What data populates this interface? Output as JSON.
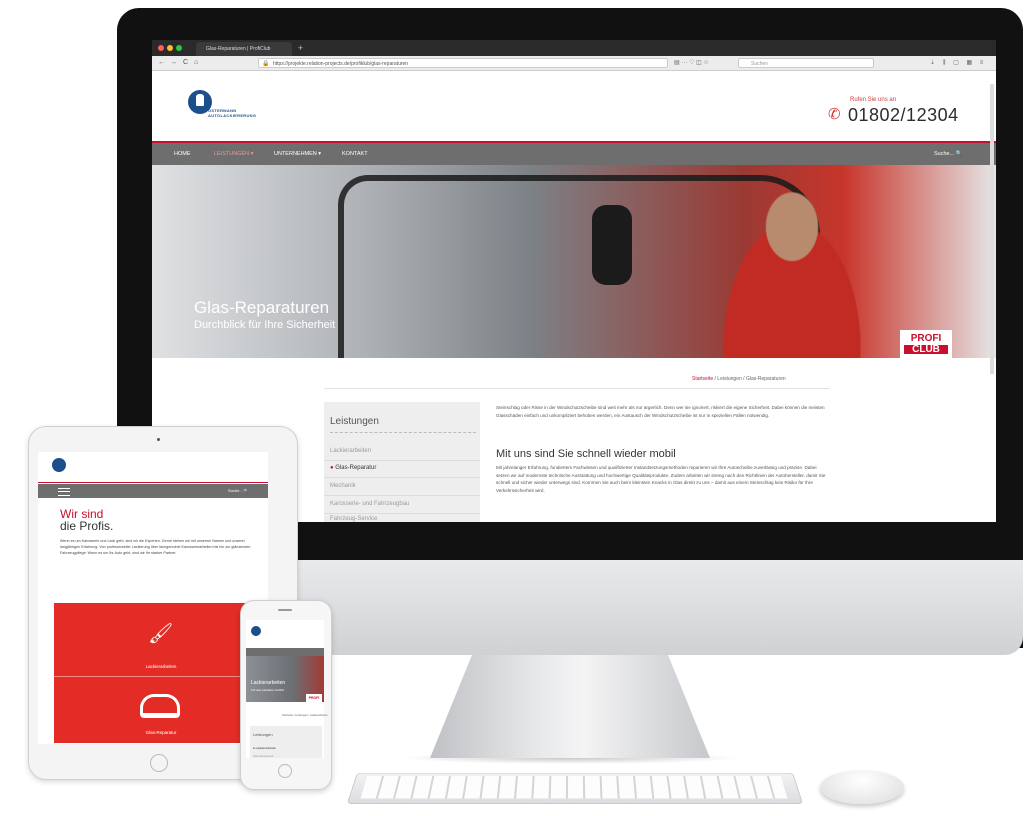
{
  "browser": {
    "tab_title": "Glas-Reparaturen | ProfiClub",
    "tab_add": "+",
    "back_glyph": "←",
    "forward_glyph": "→",
    "reload_glyph": "C",
    "home_glyph": "⌂",
    "url": "https://projekte.relation-projects.de/profiklub/glas-reparaturen",
    "url_icons": "▤ ··· ♡ ◫ ☆",
    "search_placeholder": "Suchen",
    "toolbar_icons": "⇣ ⫼ ▢ ▦ ≡"
  },
  "site": {
    "logo_text_line1": "OSTERMANN",
    "logo_text_line2": "AUTOLACKIERERUNG",
    "call_label": "Rufen Sie uns an",
    "phone": "01802/12304",
    "nav": [
      "HOME",
      "LEISTUNGEN ▾",
      "UNTERNEHMEN ▾",
      "KONTAKT"
    ],
    "search_link": "Suche... 🔍",
    "hero_title": "Glas-Reparaturen",
    "hero_subtitle": "Durchblick für Ihre Sicherheit",
    "badge_top": "PROFI",
    "badge_bottom": "CLUB",
    "breadcrumb": {
      "home": "Startseite",
      "sep": " / ",
      "section": "Leistungen",
      "current": "Glas-Reparaturen"
    },
    "sidebar": {
      "heading": "Leistungen",
      "items": [
        "Lackierarbeiten",
        "Glas-Reparatur",
        "Mechanik",
        "Karosserie- und Fahrzeugbau",
        "Fahrzeug-Service"
      ],
      "selected_bullet": "●"
    },
    "intro": "Steinschlag oder Risse in der Windschutzscheibe sind weit mehr als nur ärgerlich. Denn wer sie ignoriert, riskiert die eigene Sicherheit. Dabei können die meisten Glasschäden einfach und unkompliziert behoben werden, ein Austausch der Windschutzscheibe ist nur in speziellen Fällen notwendig.",
    "h2": "Mit uns sind Sie schnell wieder mobil",
    "body": "Mit jahrelanger Erfahrung, fundiertem Fachwissen und qualifizierter Instandsetzungsmethoden reparieren wir Ihre Autoscheibe zuverlässig und präzise. Dabei setzen wir auf modernste technische Ausstattung und hochwertige Qualitätsprodukte. Zudem arbeiten wir streng nach den Richtlinien der Autohersteller, damit Sie schnell und sicher wieder unterwegs sind. Kommen Sie auch beim kleinsten Knacks in Glas direkt zu uns – damit aus einem Steinschlag kein Risiko für Ihre Verkehrssicherheit wird."
  },
  "ipad": {
    "search_text": "Suche... 🔍",
    "headline_red": "Wir sind",
    "headline_dark": "die Profis.",
    "paragraph": "Wenn es um Karosserie und Lack geht, sind wir die Experten. Gerne stehen wir mit unserem Namen und unserer langjährigen Erfahrung. Von professioneller Lackierung über fachgerechte Karosseriearbeiten bis hin zur glänzenden Fahrzeugpflege: Wenn es um Ihr Auto geht, sind wir Ihr starker Partner.",
    "tile1_label": "Lackierarbeiten",
    "tile2_label": "Glas-Reparatur",
    "gun_glyph": "🖌"
  },
  "iphone": {
    "hero_title": "Lackierarbeiten",
    "hero_subtitle": "Für den perfekten Auftritt",
    "badge": "PROFI",
    "breadcrumb": "Startseite / Leistungen / Lackierarbeiten",
    "sidebar_heading": "Leistungen",
    "sidebar_item1": "● Lackierarbeiten",
    "sidebar_item2": "Glas-Reparatur"
  },
  "colors": {
    "brand_red": "#c8102e",
    "brand_blue": "#1d4f8c",
    "nav_gray": "#6e6e6e",
    "tile_red": "#e32c26"
  },
  "icons": [
    "apple-logo-icon",
    "phone-icon",
    "search-icon",
    "lock-icon",
    "menu-icon",
    "spray-gun-icon",
    "windshield-icon"
  ]
}
